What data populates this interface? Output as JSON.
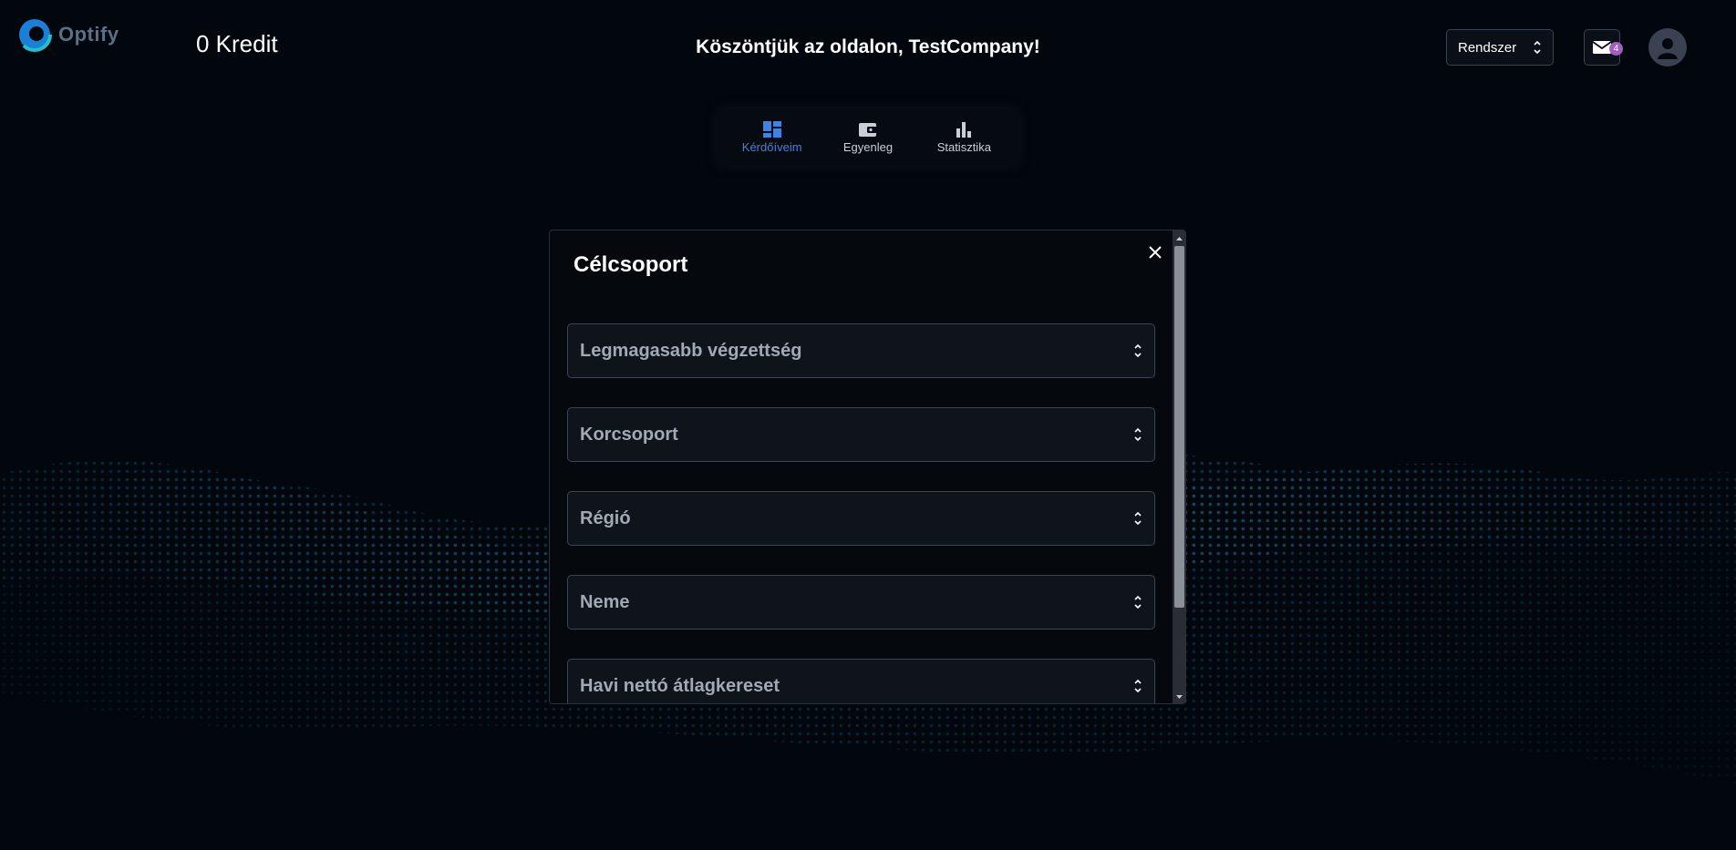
{
  "header": {
    "logo_text": "Optify",
    "credits": "0 Kredit",
    "welcome": "Köszöntjük az oldalon, TestCompany!",
    "theme_select": {
      "value": "Rendszer"
    },
    "mail_badge": "4"
  },
  "tabs": [
    {
      "label": "Kérdőíveim",
      "icon": "dashboard-icon",
      "active": true
    },
    {
      "label": "Egyenleg",
      "icon": "wallet-icon",
      "active": false
    },
    {
      "label": "Statisztika",
      "icon": "bar-chart-icon",
      "active": false
    }
  ],
  "modal": {
    "title": "Célcsoport",
    "fields": [
      {
        "placeholder": "Legmagasabb végzettség"
      },
      {
        "placeholder": "Korcsoport"
      },
      {
        "placeholder": "Régió"
      },
      {
        "placeholder": "Neme"
      },
      {
        "placeholder": "Havi nettó átlagkereset"
      }
    ]
  },
  "colors": {
    "background": "#02060d",
    "accent": "#3d82e6",
    "badge": "#a25fc2",
    "wave_teal": "#1e9a9a",
    "wave_blue": "#3a4fb0"
  }
}
